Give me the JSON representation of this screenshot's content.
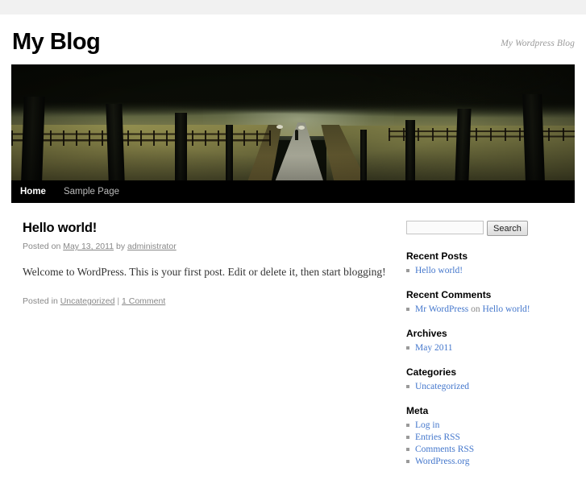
{
  "site": {
    "title": "My Blog",
    "description": "My Wordpress Blog"
  },
  "nav": {
    "items": [
      {
        "label": "Home",
        "current": true
      },
      {
        "label": "Sample Page",
        "current": false
      }
    ]
  },
  "header_image": {
    "alt": "Tree-lined path with wooden fence and sunlit grass field"
  },
  "post": {
    "title": "Hello world!",
    "meta_prefix": "Posted on ",
    "date": "May 13, 2011",
    "meta_by": " by ",
    "author": "administrator",
    "content": "Welcome to WordPress. This is your first post. Edit or delete it, then start blogging!",
    "utility_prefix": "Posted in ",
    "category": "Uncategorized",
    "utility_sep": " | ",
    "comments": "1 Comment"
  },
  "sidebar": {
    "search": {
      "value": "",
      "placeholder": "",
      "button_label": "Search"
    },
    "recent_posts": {
      "title": "Recent Posts",
      "items": [
        "Hello world!"
      ]
    },
    "recent_comments": {
      "title": "Recent Comments",
      "items": [
        {
          "author": "Mr WordPress",
          "on": " on ",
          "post": "Hello world!"
        }
      ]
    },
    "archives": {
      "title": "Archives",
      "items": [
        "May 2011"
      ]
    },
    "categories": {
      "title": "Categories",
      "items": [
        "Uncategorized"
      ]
    },
    "meta": {
      "title": "Meta",
      "items": [
        "Log in",
        "Entries RSS",
        "Comments RSS",
        "WordPress.org"
      ]
    }
  },
  "colors": {
    "link": "#4477cc",
    "nav_background": "#000000",
    "muted_text": "#888888",
    "page_background": "#f1f1f1"
  }
}
